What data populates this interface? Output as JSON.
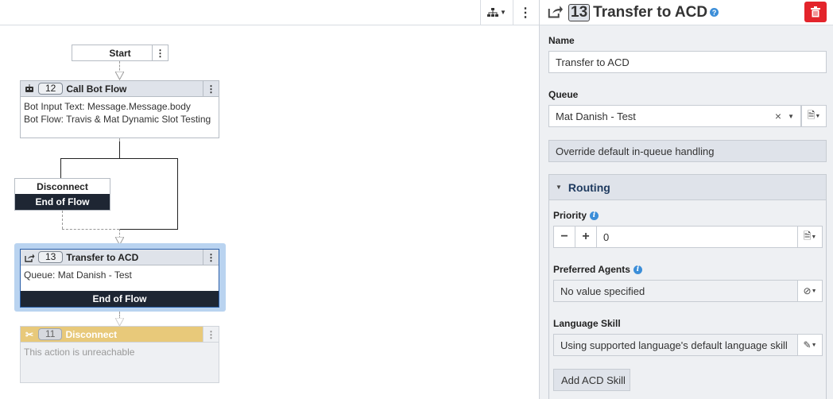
{
  "canvas": {
    "toolbar": {
      "hierarchy_icon": "sitemap-icon",
      "menu_icon": "kebab-icon"
    },
    "start": {
      "label": "Start"
    },
    "call_bot": {
      "number": "12",
      "title": "Call Bot Flow",
      "lines": [
        "Bot Input Text: Message.Message.body",
        "Bot Flow: Travis & Mat Dynamic Slot Testing"
      ]
    },
    "disconnect_a": {
      "title": "Disconnect",
      "footer": "End of Flow"
    },
    "transfer": {
      "number": "13",
      "title": "Transfer to ACD",
      "line": "Queue: Mat Danish - Test",
      "footer": "End of Flow"
    },
    "disconnect_b": {
      "number": "11",
      "title": "Disconnect",
      "note": "This action is unreachable"
    }
  },
  "panel": {
    "number": "13",
    "title": "Transfer to ACD",
    "name_label": "Name",
    "name_value": "Transfer to ACD",
    "queue_label": "Queue",
    "queue_value": "Mat Danish - Test",
    "override_label": "Override default in-queue handling",
    "routing_label": "Routing",
    "priority_label": "Priority",
    "priority_value": "0",
    "preferred_label": "Preferred Agents",
    "preferred_value": "No value specified",
    "language_label": "Language Skill",
    "language_value": "Using supported language's default language skill",
    "add_skill_label": "Add ACD Skill"
  },
  "colors": {
    "accent": "#3c8ed8",
    "delete": "#e3242b",
    "dark": "#1e2633",
    "warning": "#e8c97a"
  }
}
